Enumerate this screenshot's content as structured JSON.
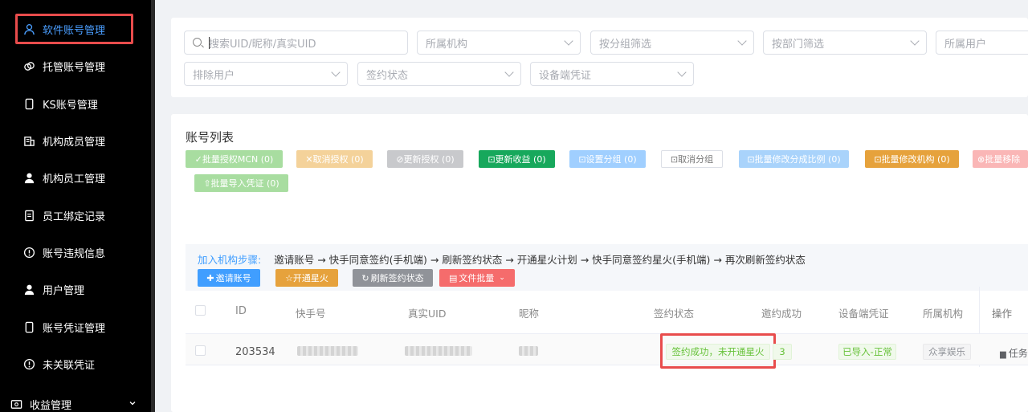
{
  "sidebar": {
    "items": [
      {
        "label": "软件账号管理",
        "icon": "user-icon"
      },
      {
        "label": "托管账号管理",
        "icon": "link-icon"
      },
      {
        "label": "KS账号管理",
        "icon": "phone-icon"
      },
      {
        "label": "机构成员管理",
        "icon": "building-icon"
      },
      {
        "label": "机构员工管理",
        "icon": "person-icon"
      },
      {
        "label": "员工绑定记录",
        "icon": "document-icon"
      },
      {
        "label": "账号违规信息",
        "icon": "alert-icon"
      },
      {
        "label": "用户管理",
        "icon": "person-icon"
      },
      {
        "label": "账号凭证管理",
        "icon": "phone-icon"
      },
      {
        "label": "未关联凭证",
        "icon": "alert-icon"
      },
      {
        "label": "收益管理",
        "icon": "wallet-icon"
      }
    ]
  },
  "filters": {
    "search_placeholder": "搜索UID/昵称/真实UID",
    "org": "所属机构",
    "group": "按分组筛选",
    "dept": "按部门筛选",
    "owner": "所属用户",
    "exclude": "排除用户",
    "sign_status": "签约状态",
    "device_cred": "设备端凭证"
  },
  "list": {
    "title": "账号列表",
    "actions": {
      "batch_auth": "✓批量授权MCN (0)",
      "cancel_auth": "✕取消授权 (0)",
      "update_auth": "⊘更新授权 (0)",
      "update_income": "⊡更新收益 (0)",
      "set_group": "⊡设置分组 (0)",
      "cancel_group": "⊡取消分组",
      "batch_ratio": "⊡批量修改分成比例 (0)",
      "batch_org": "⊡批量修改机构 (0)",
      "batch_remove": "⊗批量移除",
      "batch_import": "⇧批量导入凭证 (0)"
    },
    "steps": {
      "label": "加入机构步骤:",
      "text": "邀请账号 → 快手同意签约(手机端) → 刷新签约状态 → 开通星火计划 → 快手同意签约星火(手机端) → 再次刷新签约状态",
      "invite": "邀请账号",
      "spark": "☆开通星火",
      "refresh": "刷新签约状态",
      "file_batch": "文件批量"
    },
    "columns": {
      "id": "ID",
      "ks": "快手号",
      "uid": "真实UID",
      "nick": "昵称",
      "sign": "签约状态",
      "invite": "邀约成功",
      "device": "设备端凭证",
      "org": "所属机构",
      "op": "操作"
    },
    "rows": [
      {
        "id": "203534",
        "sign_status": "签约成功，未开通星火",
        "invite_count": "3",
        "device": "已导入-正常",
        "org": "众享娱乐",
        "op": "任务"
      }
    ]
  }
}
